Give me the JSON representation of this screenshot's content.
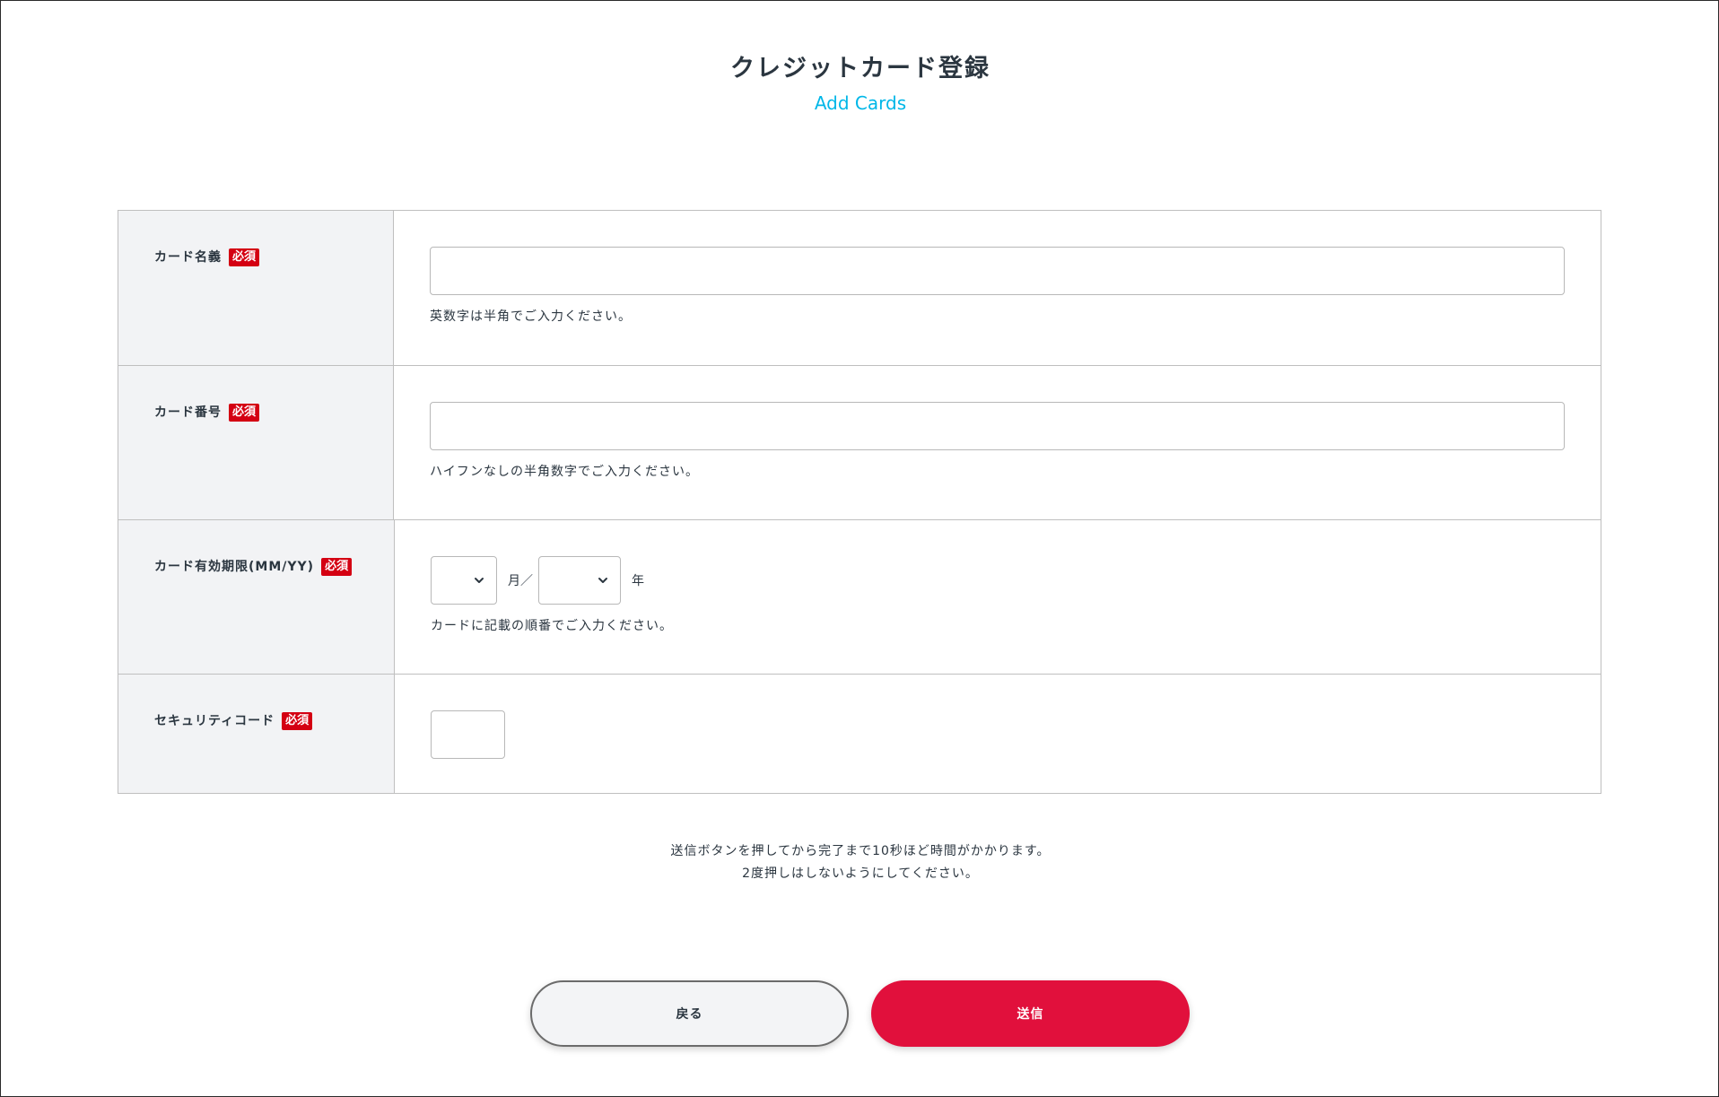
{
  "header": {
    "title": "クレジットカード登録",
    "subtitle": "Add Cards"
  },
  "required_label": "必須",
  "form": {
    "card_name": {
      "label": "カード名義",
      "value": "",
      "hint": "英数字は半角でご入力ください。"
    },
    "card_number": {
      "label": "カード番号",
      "value": "",
      "hint": "ハイフンなしの半角数字でご入力ください。"
    },
    "expiry": {
      "label": "カード有効期限(MM/YY)",
      "month_value": "",
      "month_unit": "月／",
      "year_value": "",
      "year_unit": "年",
      "hint": "カードに記載の順番でご入力ください。"
    },
    "security_code": {
      "label": "セキュリティコード",
      "value": ""
    }
  },
  "notice": {
    "line1": "送信ボタンを押してから完了まで10秒ほど時間がかかります。",
    "line2": "2度押しはしないようにしてください。"
  },
  "buttons": {
    "back": "戻る",
    "submit": "送信"
  },
  "colors": {
    "accent": "#00b7e8",
    "required": "#d40012",
    "submit": "#e1103c",
    "label_bg": "#f2f3f5"
  },
  "icons": {
    "select_arrow": "chevron-down-icon"
  }
}
